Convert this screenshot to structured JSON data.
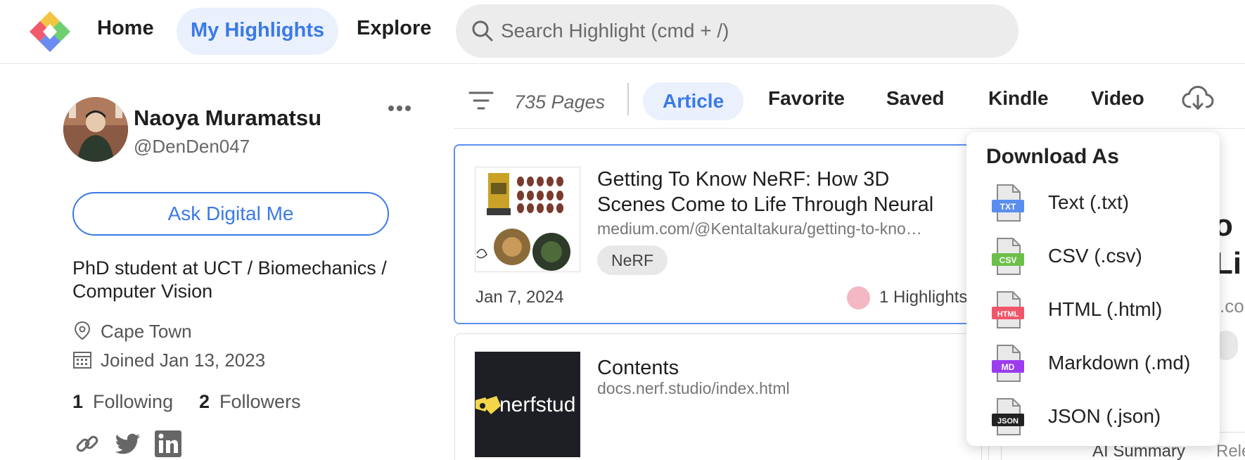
{
  "nav": {
    "home": "Home",
    "highlights": "My Highlights",
    "explore": "Explore",
    "search_placeholder": "Search Highlight (cmd + /)"
  },
  "profile": {
    "name": "Naoya Muramatsu",
    "handle": "@DenDen047",
    "ask_button": "Ask Digital Me",
    "bio": "PhD student at UCT / Biomechanics / Computer Vision",
    "location": "Cape Town",
    "joined": "Joined Jan 13, 2023",
    "following_count": "1",
    "following_label": "Following",
    "followers_count": "2",
    "followers_label": "Followers"
  },
  "filters": {
    "pages_count": "735 Pages",
    "tabs": [
      "Article",
      "Favorite",
      "Saved",
      "Kindle",
      "Video"
    ],
    "active_tab": "Article"
  },
  "cards": [
    {
      "title": "Getting To Know NeRF: How 3D Scenes Come to Life Through Neural",
      "url": "medium.com/@KentaItakura/getting-to-kno…",
      "tag": "NeRF",
      "date": "Jan 7, 2024",
      "highlights": "1 Highlights"
    },
    {
      "title": "Contents",
      "url": "docs.nerf.studio/index.html",
      "thumb_text": "nerfstud"
    }
  ],
  "peek": {
    "line1": "o",
    "line2": "Li",
    "line3": ".co",
    "ai_summary": "AI Summary",
    "related": "Rele"
  },
  "download_menu": {
    "title": "Download As",
    "items": [
      {
        "label": "Text (.txt)",
        "badge": "TXT",
        "color": "#5b8def"
      },
      {
        "label": "CSV (.csv)",
        "badge": "CSV",
        "color": "#6cc04a"
      },
      {
        "label": "HTML (.html)",
        "badge": "HTML",
        "color": "#f0566a"
      },
      {
        "label": "Markdown (.md)",
        "badge": "MD",
        "color": "#9b3cf0"
      },
      {
        "label": "JSON (.json)",
        "badge": "JSON",
        "color": "#222222"
      }
    ]
  },
  "colors": {
    "accent": "#3b7ae6",
    "accent_bg": "#eaf1fd"
  }
}
